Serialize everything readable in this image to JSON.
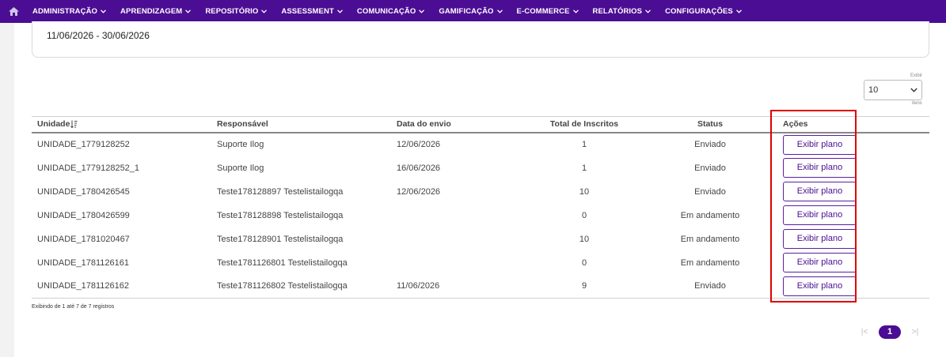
{
  "nav": {
    "items": [
      {
        "label": "ADMINISTRAÇÃO"
      },
      {
        "label": "APRENDIZAGEM"
      },
      {
        "label": "REPOSITÓRIO"
      },
      {
        "label": "ASSESSMENT"
      },
      {
        "label": "COMUNICAÇÃO"
      },
      {
        "label": "GAMIFICAÇÃO"
      },
      {
        "label": "E-COMMERCE"
      },
      {
        "label": "RELATÓRIOS"
      },
      {
        "label": "CONFIGURAÇÕES"
      }
    ]
  },
  "filter": {
    "date_range": "11/06/2026 - 30/06/2026"
  },
  "page_size": {
    "label_top": "Exibir",
    "value": "10",
    "label_bottom": "itens"
  },
  "table": {
    "headers": {
      "unit": "Unidade",
      "responsible": "Responsável",
      "sent_date": "Data do envio",
      "total": "Total de Inscritos",
      "status": "Status",
      "actions": "Ações"
    },
    "rows": [
      {
        "unit": "UNIDADE_1779128252",
        "responsible": "Suporte Ilog",
        "sent_date": "12/06/2026",
        "total": "1",
        "status": "Enviado",
        "action": "Exibir plano"
      },
      {
        "unit": "UNIDADE_1779128252_1",
        "responsible": "Suporte Ilog",
        "sent_date": "16/06/2026",
        "total": "1",
        "status": "Enviado",
        "action": "Exibir plano"
      },
      {
        "unit": "UNIDADE_1780426545",
        "responsible": "Teste178128897 Testelistailogqa",
        "sent_date": "12/06/2026",
        "total": "10",
        "status": "Enviado",
        "action": "Exibir plano"
      },
      {
        "unit": "UNIDADE_1780426599",
        "responsible": "Teste178128898 Testelistailogqa",
        "sent_date": "",
        "total": "0",
        "status": "Em andamento",
        "action": "Exibir plano"
      },
      {
        "unit": "UNIDADE_1781020467",
        "responsible": "Teste178128901 Testelistailogqa",
        "sent_date": "",
        "total": "10",
        "status": "Em andamento",
        "action": "Exibir plano"
      },
      {
        "unit": "UNIDADE_1781126161",
        "responsible": "Teste1781126801 Testelistailogqa",
        "sent_date": "",
        "total": "0",
        "status": "Em andamento",
        "action": "Exibir plano"
      },
      {
        "unit": "UNIDADE_1781126162",
        "responsible": "Teste1781126802 Testelistailogqa",
        "sent_date": "11/06/2026",
        "total": "9",
        "status": "Enviado",
        "action": "Exibir plano"
      }
    ]
  },
  "records_info": "Exibindo de 1 até 7 de 7 registros",
  "pagination": {
    "first": "|<",
    "current": "1",
    "last": ">|"
  },
  "colors": {
    "brand": "#4b0d93",
    "highlight": "#e00000"
  },
  "icons": {
    "home": "home-icon",
    "chevron": "chevron-down-icon",
    "sort": "sort-icon"
  }
}
